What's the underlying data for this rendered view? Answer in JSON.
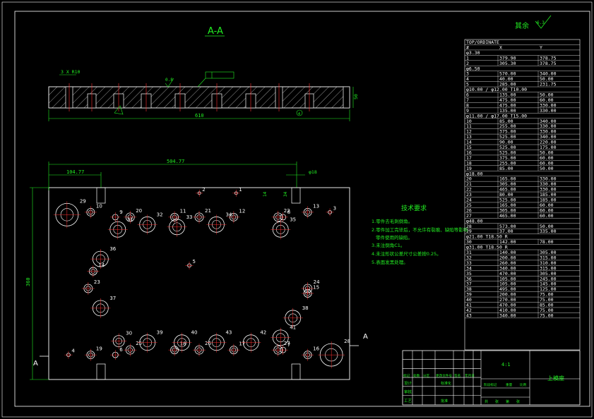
{
  "section_title": "A-A",
  "surface_note": "其余",
  "surface_value": "6.3",
  "section_dims": {
    "width": "610",
    "slot": "3 X R10",
    "thickness": "50",
    "roughness": "0.8",
    "hole": "4"
  },
  "plan_dims": {
    "overall": "504.77",
    "left_offset": "104.77",
    "right_offset": "φ18",
    "height": "360",
    "depth": "14",
    "depth2": "34"
  },
  "cut_marks": [
    "A",
    "A"
  ],
  "tech_req": {
    "title": "技术要求",
    "items": [
      "1.零件去毛刺倒角。",
      "2.零件加工完毕后，不允许有裂痕、缺陷等影响零件使用的缺陷。",
      "3.未注倒角C1。",
      "4.未注形状公差尺寸公差按0.25。",
      "5.表面发黑处理。"
    ]
  },
  "hole_table": {
    "header": "TOP/ORDINATE",
    "columns": [
      "#",
      "X",
      "Y"
    ],
    "groups": [
      {
        "label": "φ3.30",
        "rows": [
          [
            "1",
            "379.90",
            "378.75"
          ],
          [
            "2",
            "305.30",
            "378.75"
          ]
        ]
      },
      {
        "label": "φ6.50",
        "rows": [
          [
            "3",
            "570.00",
            "340.00"
          ],
          [
            "4",
            "40.00",
            "50.00"
          ],
          [
            "5",
            "285.00",
            "231.75"
          ]
        ]
      },
      {
        "label": "φ10.00 / φ12.00 T10.00",
        "rows": [
          [
            "6",
            "135.00",
            "50.00"
          ],
          [
            "7",
            "475.00",
            "60.00"
          ],
          [
            "8",
            "475.00",
            "330.00"
          ],
          [
            "9",
            "135.00",
            "330.00"
          ]
        ]
      },
      {
        "label": "φ11.00 / φ17.00 T15.00",
        "rows": [
          [
            "10",
            "85.00",
            "340.00"
          ],
          [
            "11",
            "255.00",
            "330.00"
          ],
          [
            "12",
            "375.00",
            "330.00"
          ],
          [
            "13",
            "525.00",
            "340.00"
          ],
          [
            "14",
            "90.00",
            "220.00"
          ],
          [
            "15",
            "525.00",
            "175.00"
          ],
          [
            "16",
            "525.00",
            "50.00"
          ],
          [
            "17",
            "375.00",
            "60.00"
          ],
          [
            "18",
            "255.00",
            "60.00"
          ],
          [
            "19",
            "85.00",
            "50.00"
          ]
        ]
      },
      {
        "label": "φ18.00",
        "rows": [
          [
            "20",
            "165.00",
            "330.00"
          ],
          [
            "21",
            "305.00",
            "330.00"
          ],
          [
            "22",
            "465.00",
            "330.00"
          ],
          [
            "23",
            "80.00",
            "185.00"
          ],
          [
            "24",
            "525.00",
            "185.00"
          ],
          [
            "25",
            "165.00",
            "60.00"
          ],
          [
            "26",
            "305.00",
            "60.00"
          ],
          [
            "27",
            "465.00",
            "60.00"
          ]
        ]
      },
      {
        "label": "φ48.00",
        "rows": [
          [
            "28",
            "573.00",
            "50.00"
          ],
          [
            "29",
            "37.00",
            "335.00"
          ]
        ]
      },
      {
        "label": "φ21.00 T18.50 R",
        "rows": [
          [
            "30",
            "142.00",
            "78.00"
          ]
        ]
      },
      {
        "label": "φ31.00 T18.50 R",
        "rows": [
          [
            "31",
            "140.00",
            "305.00"
          ],
          [
            "32",
            "200.00",
            "315.00"
          ],
          [
            "33",
            "260.00",
            "310.00"
          ],
          [
            "34",
            "340.00",
            "315.00"
          ],
          [
            "35",
            "470.00",
            "305.00"
          ],
          [
            "36",
            "105.00",
            "245.00"
          ],
          [
            "37",
            "105.00",
            "145.00"
          ],
          [
            "38",
            "495.00",
            "125.00"
          ],
          [
            "39",
            "200.00",
            "75.00"
          ],
          [
            "40",
            "270.00",
            "75.00"
          ],
          [
            "41",
            "470.00",
            "85.00"
          ],
          [
            "42",
            "410.00",
            "75.00"
          ],
          [
            "43",
            "340.00",
            "75.00"
          ]
        ]
      }
    ]
  },
  "title_block": {
    "scale": "4:1",
    "part_name": "上模座",
    "left_labels": [
      "标记",
      "处数",
      "分区",
      "更改文件号",
      "签名",
      "年月日"
    ],
    "rows": [
      "设计",
      "审核",
      "工艺"
    ],
    "mid_labels": [
      "标准化",
      "批准"
    ],
    "stage": "阶段标记",
    "weight": "重量",
    "ratio": "比例",
    "bottom": [
      "共",
      "张",
      "第",
      "张"
    ]
  },
  "colors": {
    "background": "#000000",
    "outline": "#ffffff",
    "annotation": "#22ee22",
    "center": "#ff3030"
  }
}
